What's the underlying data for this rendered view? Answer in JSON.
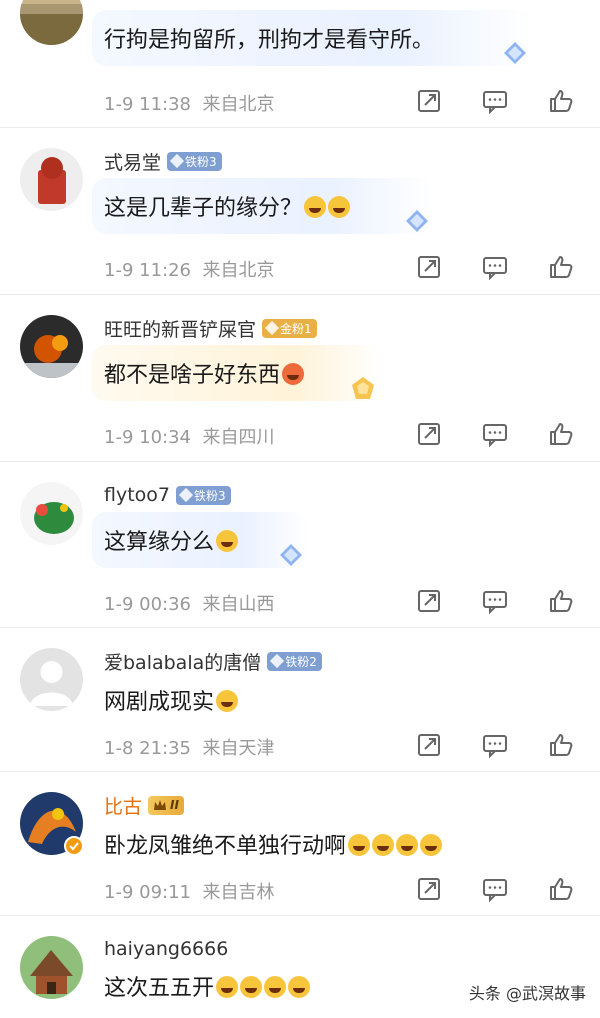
{
  "comments": [
    {
      "name": "",
      "badge": "",
      "text": "行拘是拘留所，刑拘才是看守所。",
      "time": "1-9 11:38",
      "location": "来自北京"
    },
    {
      "name": "式易堂",
      "badge": "铁粉3",
      "text": "这是几辈子的缘分？",
      "time": "1-9 11:26",
      "location": "来自北京"
    },
    {
      "name": "旺旺的新晋铲屎官",
      "badge": "金粉1",
      "text": "都不是啥子好东西",
      "time": "1-9 10:34",
      "location": "来自四川"
    },
    {
      "name": "flytoo7",
      "badge": "铁粉3",
      "text": "这算缘分么",
      "time": "1-9 00:36",
      "location": "来自山西"
    },
    {
      "name": "爱balabala的唐僧",
      "badge": "铁粉2",
      "text": "网剧成现实",
      "time": "1-8 21:35",
      "location": "来自天津"
    },
    {
      "name": "比古",
      "badge": "II",
      "text": "卧龙凤雏绝不单独行动啊",
      "time": "1-9 09:11",
      "location": "来自吉林"
    },
    {
      "name": "haiyang6666",
      "badge": "",
      "text": "这次五五开",
      "time": "",
      "location": ""
    }
  ],
  "icons": {
    "share": "share-icon",
    "comment": "comment-icon",
    "like": "like-icon"
  },
  "watermark": "头条 @武溟故事",
  "colors": {
    "vip_name": "#e07010",
    "iron_badge": "#7f9fd3",
    "gold_badge": "#e8b045",
    "meta": "#999999"
  }
}
